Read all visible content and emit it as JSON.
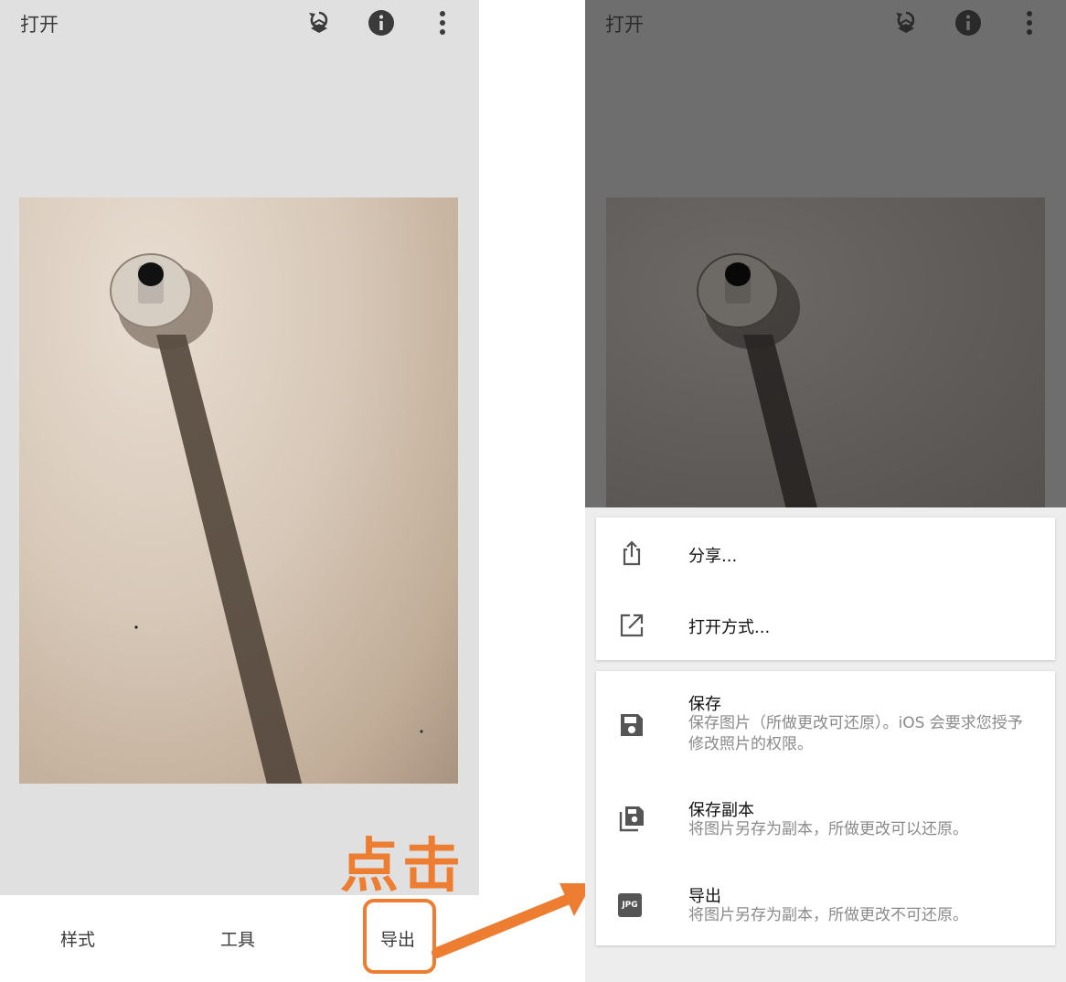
{
  "left_screen": {
    "title": "打开",
    "toolbar_icons": [
      "undo-layers-icon",
      "info-icon",
      "more-vert-icon"
    ],
    "bottom_tabs": [
      "样式",
      "工具",
      "导出"
    ],
    "annotation": "点击",
    "accent_color": "#ed7d31"
  },
  "right_screen": {
    "title": "打开",
    "share_menu": [
      {
        "label": "分享...",
        "icon": "share-icon"
      },
      {
        "label": "打开方式...",
        "icon": "open-external-icon"
      }
    ],
    "save_menu": [
      {
        "title": "保存",
        "description": "保存图片（所做更改可还原）。iOS 会要求您授予修改照片的权限。",
        "icon": "save-icon"
      },
      {
        "title": "保存副本",
        "description": "将图片另存为副本，所做更改可以还原。",
        "icon": "save-copy-icon"
      },
      {
        "title": "导出",
        "description": "将图片另存为副本，所做更改不可还原。",
        "icon": "jpg-icon",
        "icon_text": "JPG"
      }
    ]
  }
}
